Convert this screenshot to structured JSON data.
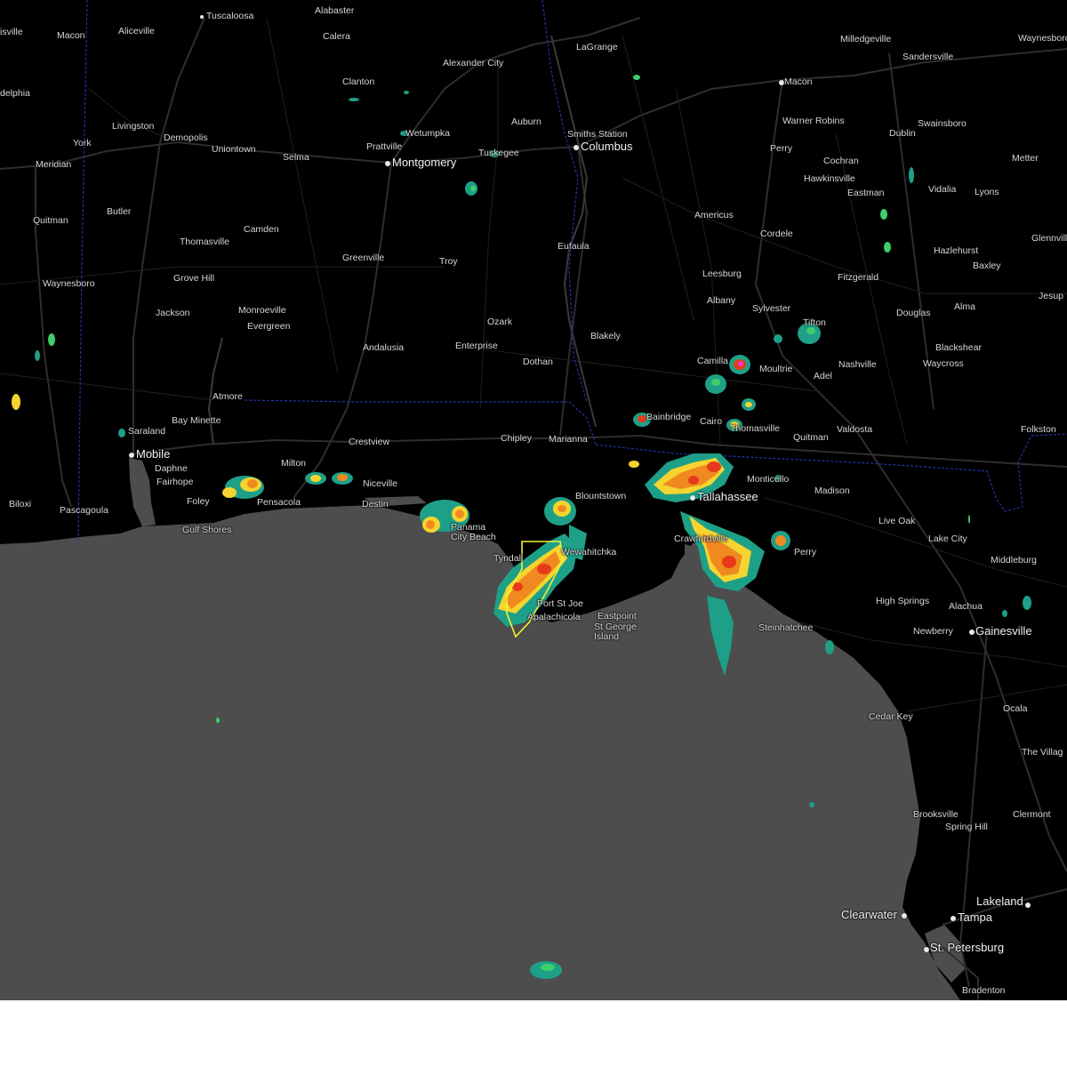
{
  "map": {
    "colors": {
      "land": "#000000",
      "water": "#4d4d4d",
      "road": "#2e2e2e",
      "state_border": "#2233aa",
      "warning_polygon": "#f2f230",
      "radar_light": "#1ea088",
      "radar_green": "#3fcf6a",
      "radar_yellow": "#f5d430",
      "radar_orange": "#f08a20",
      "radar_red": "#e8391a",
      "radar_magenta": "#e040d0"
    },
    "cities": [
      {
        "name": "Tuscaloosa",
        "size": "normal"
      },
      {
        "name": "Alabaster",
        "size": "normal"
      },
      {
        "name": "LaGrange",
        "size": "normal"
      },
      {
        "name": "Milledgeville",
        "size": "normal"
      },
      {
        "name": "Waynesboro",
        "size": "normal"
      },
      {
        "name": "Aliceville",
        "size": "normal"
      },
      {
        "name": "Macon",
        "size": "normal"
      },
      {
        "name": "isville",
        "size": "normal"
      },
      {
        "name": "Calera",
        "size": "normal"
      },
      {
        "name": "Sandersville",
        "size": "normal"
      },
      {
        "name": "Alexander City",
        "size": "normal"
      },
      {
        "name": "delphia",
        "size": "normal"
      },
      {
        "name": "Macon",
        "size": "normal"
      },
      {
        "name": "Clanton",
        "size": "normal"
      },
      {
        "name": "Livingston",
        "size": "normal"
      },
      {
        "name": "Auburn",
        "size": "normal"
      },
      {
        "name": "Warner Robins",
        "size": "normal"
      },
      {
        "name": "Swainsboro",
        "size": "normal"
      },
      {
        "name": "Wetumpka",
        "size": "normal"
      },
      {
        "name": "Smiths Station",
        "size": "normal"
      },
      {
        "name": "Dublin",
        "size": "normal"
      },
      {
        "name": "Demopolis",
        "size": "normal"
      },
      {
        "name": "York",
        "size": "normal"
      },
      {
        "name": "Prattville",
        "size": "normal"
      },
      {
        "name": "Columbus",
        "size": "big"
      },
      {
        "name": "Uniontown",
        "size": "normal"
      },
      {
        "name": "Tuskegee",
        "size": "normal"
      },
      {
        "name": "Perry",
        "size": "normal"
      },
      {
        "name": "Selma",
        "size": "normal"
      },
      {
        "name": "Montgomery",
        "size": "big"
      },
      {
        "name": "Cochran",
        "size": "normal"
      },
      {
        "name": "Metter",
        "size": "normal"
      },
      {
        "name": "Meridian",
        "size": "normal"
      },
      {
        "name": "Hawkinsville",
        "size": "normal"
      },
      {
        "name": "Eastman",
        "size": "normal"
      },
      {
        "name": "Vidalia",
        "size": "normal"
      },
      {
        "name": "Lyons",
        "size": "normal"
      },
      {
        "name": "Butler",
        "size": "normal"
      },
      {
        "name": "Americus",
        "size": "normal"
      },
      {
        "name": "Quitman",
        "size": "normal"
      },
      {
        "name": "Camden",
        "size": "normal"
      },
      {
        "name": "Cordele",
        "size": "normal"
      },
      {
        "name": "Glennvill",
        "size": "normal"
      },
      {
        "name": "Thomasville",
        "size": "normal"
      },
      {
        "name": "Eufaula",
        "size": "normal"
      },
      {
        "name": "Hazlehurst",
        "size": "normal"
      },
      {
        "name": "Greenville",
        "size": "normal"
      },
      {
        "name": "Troy",
        "size": "normal"
      },
      {
        "name": "Baxley",
        "size": "normal"
      },
      {
        "name": "Leesburg",
        "size": "normal"
      },
      {
        "name": "Grove Hill",
        "size": "normal"
      },
      {
        "name": "Fitzgerald",
        "size": "normal"
      },
      {
        "name": "Waynesboro",
        "size": "normal"
      },
      {
        "name": "Jesup",
        "size": "normal"
      },
      {
        "name": "Albany",
        "size": "normal"
      },
      {
        "name": "Monroeville",
        "size": "normal"
      },
      {
        "name": "Sylvester",
        "size": "normal"
      },
      {
        "name": "Douglas",
        "size": "normal"
      },
      {
        "name": "Alma",
        "size": "normal"
      },
      {
        "name": "Jackson",
        "size": "normal"
      },
      {
        "name": "Ozark",
        "size": "normal"
      },
      {
        "name": "Evergreen",
        "size": "normal"
      },
      {
        "name": "Tifton",
        "size": "normal"
      },
      {
        "name": "Blakely",
        "size": "normal"
      },
      {
        "name": "Andalusia",
        "size": "normal"
      },
      {
        "name": "Enterprise",
        "size": "normal"
      },
      {
        "name": "Blackshear",
        "size": "normal"
      },
      {
        "name": "Camilla",
        "size": "normal"
      },
      {
        "name": "Moultrie",
        "size": "normal"
      },
      {
        "name": "Dothan",
        "size": "normal"
      },
      {
        "name": "Nashville",
        "size": "normal"
      },
      {
        "name": "Waycross",
        "size": "normal"
      },
      {
        "name": "Adel",
        "size": "normal"
      },
      {
        "name": "Atmore",
        "size": "normal"
      },
      {
        "name": "Bainbridge",
        "size": "normal"
      },
      {
        "name": "Cairo",
        "size": "normal"
      },
      {
        "name": "Thomasville",
        "size": "normal"
      },
      {
        "name": "Bay Minette",
        "size": "normal"
      },
      {
        "name": "Valdosta",
        "size": "normal"
      },
      {
        "name": "Folkston",
        "size": "normal"
      },
      {
        "name": "Saraland",
        "size": "normal"
      },
      {
        "name": "Quitman",
        "size": "normal"
      },
      {
        "name": "Crestview",
        "size": "normal"
      },
      {
        "name": "Chipley",
        "size": "normal"
      },
      {
        "name": "Marianna",
        "size": "normal"
      },
      {
        "name": "Mobile",
        "size": "big"
      },
      {
        "name": "Daphne",
        "size": "normal"
      },
      {
        "name": "Milton",
        "size": "normal"
      },
      {
        "name": "Fairhope",
        "size": "normal"
      },
      {
        "name": "Monticello",
        "size": "normal"
      },
      {
        "name": "Niceville",
        "size": "normal"
      },
      {
        "name": "Madison",
        "size": "normal"
      },
      {
        "name": "Blountstown",
        "size": "normal"
      },
      {
        "name": "Tallahassee",
        "size": "big"
      },
      {
        "name": "Foley",
        "size": "normal"
      },
      {
        "name": "Pensacola",
        "size": "normal"
      },
      {
        "name": "Biloxi",
        "size": "normal"
      },
      {
        "name": "Pascagoula",
        "size": "normal"
      },
      {
        "name": "Destin",
        "size": "normal"
      },
      {
        "name": "Live Oak",
        "size": "normal"
      },
      {
        "name": "Gulf Shores",
        "size": "normal"
      },
      {
        "name": "Panama City Beach",
        "size": "normal"
      },
      {
        "name": "Crawfordville",
        "size": "normal"
      },
      {
        "name": "Lake City",
        "size": "normal"
      },
      {
        "name": "Perry",
        "size": "normal"
      },
      {
        "name": "Wewahitchka",
        "size": "normal"
      },
      {
        "name": "Tyndall",
        "size": "normal"
      },
      {
        "name": "Middleburg",
        "size": "normal"
      },
      {
        "name": "Port St Joe",
        "size": "normal"
      },
      {
        "name": "High Springs",
        "size": "normal"
      },
      {
        "name": "Alachua",
        "size": "normal"
      },
      {
        "name": "Apalachicola",
        "size": "normal"
      },
      {
        "name": "Eastpoint",
        "size": "normal"
      },
      {
        "name": "St George Island",
        "size": "normal"
      },
      {
        "name": "Newberry",
        "size": "normal"
      },
      {
        "name": "Gainesville",
        "size": "big"
      },
      {
        "name": "Steinhatchee",
        "size": "normal"
      },
      {
        "name": "Ocala",
        "size": "normal"
      },
      {
        "name": "Cedar Key",
        "size": "normal"
      },
      {
        "name": "The Villag",
        "size": "normal"
      },
      {
        "name": "Brooksville",
        "size": "normal"
      },
      {
        "name": "Clermont",
        "size": "normal"
      },
      {
        "name": "Spring Hill",
        "size": "normal"
      },
      {
        "name": "Lakeland",
        "size": "big"
      },
      {
        "name": "Clearwater",
        "size": "big"
      },
      {
        "name": "Tampa",
        "size": "big"
      },
      {
        "name": "St. Petersburg",
        "size": "big"
      },
      {
        "name": "Bradenton",
        "size": "normal"
      }
    ]
  }
}
